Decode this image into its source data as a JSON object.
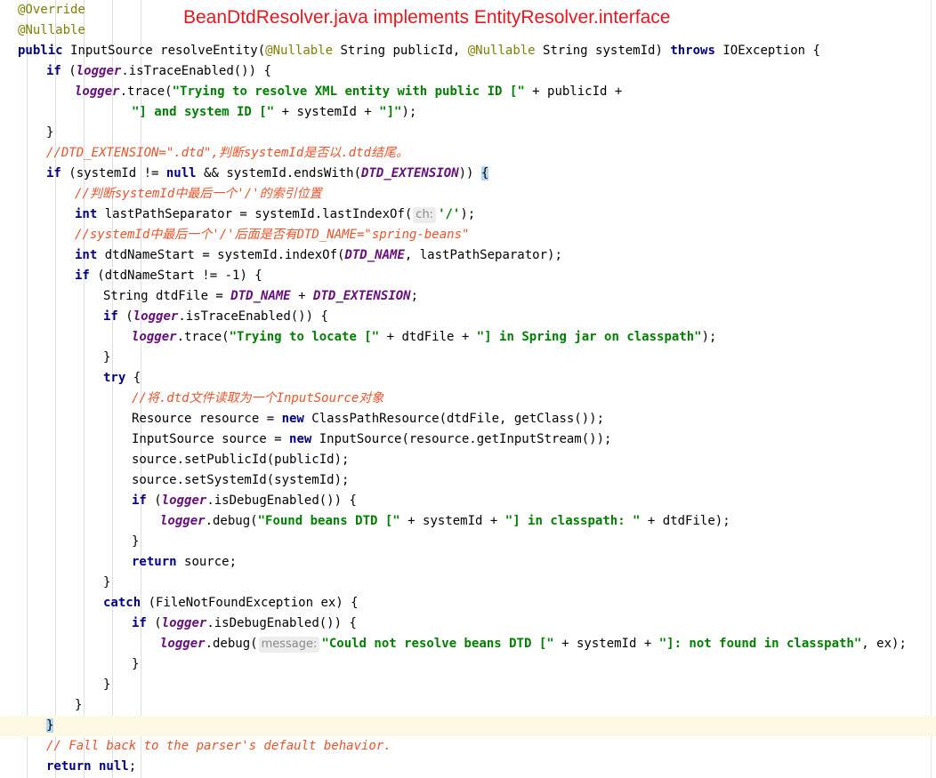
{
  "title": "BeanDtdResolver.java implements EntityResolver.interface",
  "lines": [
    {
      "indent": 20,
      "tokens": [
        {
          "c": "an",
          "t": "@Override"
        }
      ]
    },
    {
      "indent": 20,
      "tokens": [
        {
          "c": "an",
          "t": "@Nullable"
        }
      ]
    },
    {
      "indent": 20,
      "tokens": [
        {
          "c": "kw",
          "t": "public "
        },
        {
          "c": "t",
          "t": "InputSource resolveEntity("
        },
        {
          "c": "an",
          "t": "@Nullable"
        },
        {
          "c": "t",
          "t": " String publicId, "
        },
        {
          "c": "an",
          "t": "@Nullable"
        },
        {
          "c": "t",
          "t": " String systemId) "
        },
        {
          "c": "kw",
          "t": "throws "
        },
        {
          "c": "t",
          "t": "IOException {"
        }
      ]
    },
    {
      "indent": 52,
      "tokens": [
        {
          "c": "kw",
          "t": "if "
        },
        {
          "c": "t",
          "t": "("
        },
        {
          "c": "fi",
          "t": "logger"
        },
        {
          "c": "t",
          "t": ".isTraceEnabled()) {"
        }
      ]
    },
    {
      "indent": 84,
      "tokens": [
        {
          "c": "fi",
          "t": "logger"
        },
        {
          "c": "t",
          "t": ".trace("
        },
        {
          "c": "st",
          "t": "\"Trying to resolve XML entity with public ID [\""
        },
        {
          "c": "t",
          "t": " + publicId +"
        }
      ]
    },
    {
      "indent": 148,
      "tokens": [
        {
          "c": "st",
          "t": "\"] and system ID [\""
        },
        {
          "c": "t",
          "t": " + systemId + "
        },
        {
          "c": "st",
          "t": "\"]\""
        },
        {
          "c": "t",
          "t": ");"
        }
      ]
    },
    {
      "indent": 52,
      "tokens": [
        {
          "c": "t",
          "t": "}"
        }
      ]
    },
    {
      "indent": 52,
      "tokens": [
        {
          "c": "cm",
          "t": "//DTD_EXTENSION=\".dtd\",判断systemId是否以.dtd结尾。"
        }
      ]
    },
    {
      "indent": 52,
      "tokens": [
        {
          "c": "kw",
          "t": "if "
        },
        {
          "c": "t",
          "t": "(systemId != "
        },
        {
          "c": "kw",
          "t": "null "
        },
        {
          "c": "t",
          "t": "&& systemId.endsWith("
        },
        {
          "c": "fi",
          "t": "DTD_EXTENSION"
        },
        {
          "c": "t",
          "t": ")) "
        },
        {
          "c": "brace",
          "t": "{"
        }
      ]
    },
    {
      "indent": 84,
      "tokens": [
        {
          "c": "cm",
          "t": "//判断systemId中最后一个'/'的索引位置"
        }
      ]
    },
    {
      "indent": 84,
      "tokens": [
        {
          "c": "kw",
          "t": "int "
        },
        {
          "c": "t",
          "t": "lastPathSeparator = systemId.lastIndexOf("
        },
        {
          "c": "hint",
          "t": "ch:"
        },
        {
          "c": "st",
          "t": "'/'"
        },
        {
          "c": "t",
          "t": ");"
        }
      ]
    },
    {
      "indent": 84,
      "tokens": [
        {
          "c": "cm",
          "t": "//systemId中最后一个'/'后面是否有DTD_NAME=\"spring-beans\""
        }
      ]
    },
    {
      "indent": 84,
      "tokens": [
        {
          "c": "kw",
          "t": "int "
        },
        {
          "c": "t",
          "t": "dtdNameStart = systemId.indexOf("
        },
        {
          "c": "fi",
          "t": "DTD_NAME"
        },
        {
          "c": "t",
          "t": ", lastPathSeparator);"
        }
      ]
    },
    {
      "indent": 84,
      "tokens": [
        {
          "c": "kw",
          "t": "if "
        },
        {
          "c": "t",
          "t": "(dtdNameStart != -1) {"
        }
      ]
    },
    {
      "indent": 116,
      "tokens": [
        {
          "c": "t",
          "t": "String dtdFile = "
        },
        {
          "c": "fi",
          "t": "DTD_NAME"
        },
        {
          "c": "t",
          "t": " + "
        },
        {
          "c": "fi",
          "t": "DTD_EXTENSION"
        },
        {
          "c": "t",
          "t": ";"
        }
      ]
    },
    {
      "indent": 116,
      "tokens": [
        {
          "c": "kw",
          "t": "if "
        },
        {
          "c": "t",
          "t": "("
        },
        {
          "c": "fi",
          "t": "logger"
        },
        {
          "c": "t",
          "t": ".isTraceEnabled()) {"
        }
      ]
    },
    {
      "indent": 148,
      "tokens": [
        {
          "c": "fi",
          "t": "logger"
        },
        {
          "c": "t",
          "t": ".trace("
        },
        {
          "c": "st",
          "t": "\"Trying to locate [\""
        },
        {
          "c": "t",
          "t": " + dtdFile + "
        },
        {
          "c": "st",
          "t": "\"] in Spring jar on classpath\""
        },
        {
          "c": "t",
          "t": ");"
        }
      ]
    },
    {
      "indent": 116,
      "tokens": [
        {
          "c": "t",
          "t": "}"
        }
      ]
    },
    {
      "indent": 116,
      "tokens": [
        {
          "c": "kw",
          "t": "try "
        },
        {
          "c": "t",
          "t": "{"
        }
      ]
    },
    {
      "indent": 148,
      "tokens": [
        {
          "c": "cm",
          "t": "//将.dtd文件读取为一个InputSource对象"
        }
      ]
    },
    {
      "indent": 148,
      "tokens": [
        {
          "c": "t",
          "t": "Resource resource = "
        },
        {
          "c": "kw",
          "t": "new "
        },
        {
          "c": "t",
          "t": "ClassPathResource(dtdFile, getClass());"
        }
      ]
    },
    {
      "indent": 148,
      "tokens": [
        {
          "c": "t",
          "t": "InputSource source = "
        },
        {
          "c": "kw",
          "t": "new "
        },
        {
          "c": "t",
          "t": "InputSource(resource.getInputStream());"
        }
      ]
    },
    {
      "indent": 148,
      "tokens": [
        {
          "c": "t",
          "t": "source.setPublicId(publicId);"
        }
      ]
    },
    {
      "indent": 148,
      "tokens": [
        {
          "c": "t",
          "t": "source.setSystemId(systemId);"
        }
      ]
    },
    {
      "indent": 148,
      "tokens": [
        {
          "c": "kw",
          "t": "if "
        },
        {
          "c": "t",
          "t": "("
        },
        {
          "c": "fi",
          "t": "logger"
        },
        {
          "c": "t",
          "t": ".isDebugEnabled()) {"
        }
      ]
    },
    {
      "indent": 180,
      "tokens": [
        {
          "c": "fi",
          "t": "logger"
        },
        {
          "c": "t",
          "t": ".debug("
        },
        {
          "c": "st",
          "t": "\"Found beans DTD [\""
        },
        {
          "c": "t",
          "t": " + systemId + "
        },
        {
          "c": "st",
          "t": "\"] in classpath: \""
        },
        {
          "c": "t",
          "t": " + dtdFile);"
        }
      ]
    },
    {
      "indent": 148,
      "tokens": [
        {
          "c": "t",
          "t": "}"
        }
      ]
    },
    {
      "indent": 148,
      "tokens": [
        {
          "c": "kw",
          "t": "return "
        },
        {
          "c": "t",
          "t": "source;"
        }
      ]
    },
    {
      "indent": 116,
      "tokens": [
        {
          "c": "t",
          "t": "}"
        }
      ]
    },
    {
      "indent": 116,
      "tokens": [
        {
          "c": "kw",
          "t": "catch "
        },
        {
          "c": "t",
          "t": "(FileNotFoundException ex) {"
        }
      ]
    },
    {
      "indent": 148,
      "tokens": [
        {
          "c": "kw",
          "t": "if "
        },
        {
          "c": "t",
          "t": "("
        },
        {
          "c": "fi",
          "t": "logger"
        },
        {
          "c": "t",
          "t": ".isDebugEnabled()) {"
        }
      ]
    },
    {
      "indent": 180,
      "tokens": [
        {
          "c": "fi",
          "t": "logger"
        },
        {
          "c": "t",
          "t": ".debug("
        },
        {
          "c": "hint",
          "t": "message:"
        },
        {
          "c": "st",
          "t": "\"Could not resolve beans DTD [\""
        },
        {
          "c": "t",
          "t": " + systemId + "
        },
        {
          "c": "st",
          "t": "\"]: not found in classpath\""
        },
        {
          "c": "t",
          "t": ", ex);"
        }
      ]
    },
    {
      "indent": 148,
      "tokens": [
        {
          "c": "t",
          "t": "}"
        }
      ]
    },
    {
      "indent": 116,
      "tokens": [
        {
          "c": "t",
          "t": "}"
        }
      ]
    },
    {
      "indent": 84,
      "tokens": [
        {
          "c": "t",
          "t": "}"
        }
      ]
    },
    {
      "indent": 52,
      "highlight": true,
      "tokens": [
        {
          "c": "brace",
          "t": "}"
        }
      ]
    },
    {
      "indent": 52,
      "tokens": [
        {
          "c": "cm",
          "t": "// Fall back to the parser's default behavior."
        }
      ]
    },
    {
      "indent": 52,
      "tokens": [
        {
          "c": "kw",
          "t": "return null"
        },
        {
          "c": "t",
          "t": ";"
        }
      ]
    }
  ]
}
